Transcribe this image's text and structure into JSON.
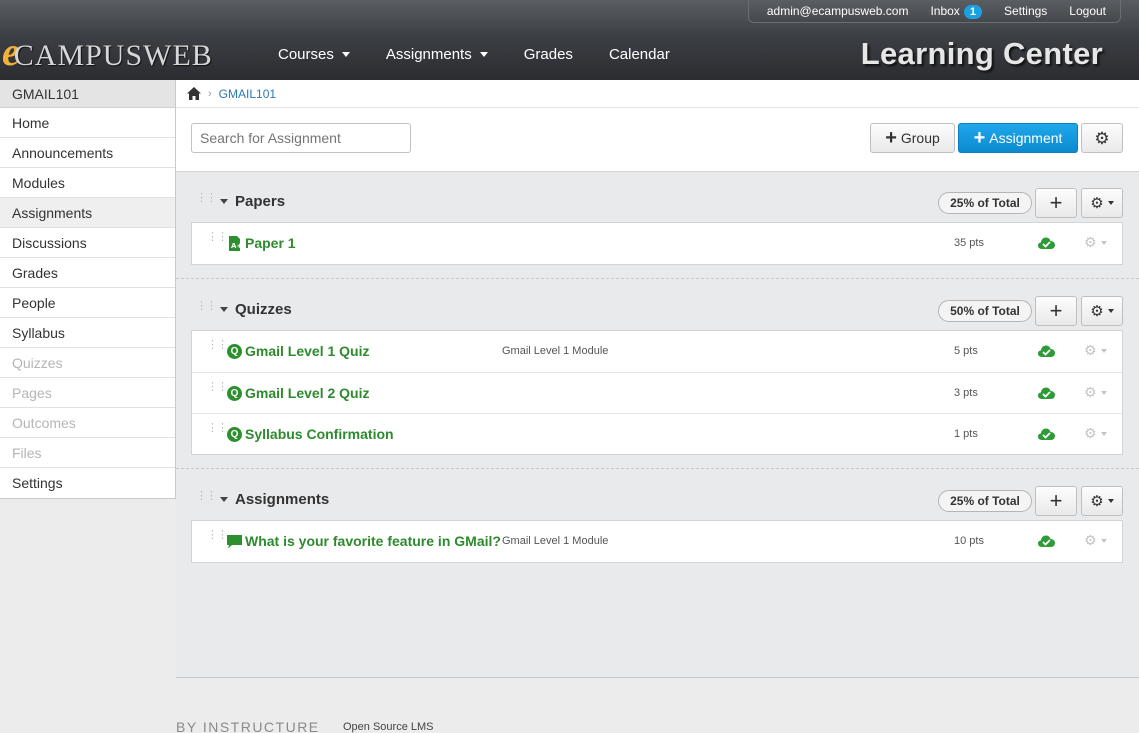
{
  "header": {
    "logo_e": "e",
    "logo_text": "CAMPUSWEB",
    "user_email": "admin@ecampusweb.com",
    "inbox_label": "Inbox",
    "inbox_count": "1",
    "settings_label": "Settings",
    "logout_label": "Logout",
    "nav": [
      {
        "label": "Courses"
      },
      {
        "label": "Assignments"
      },
      {
        "label": "Grades"
      },
      {
        "label": "Calendar"
      }
    ],
    "brand_title": "Learning Center"
  },
  "sidebar": {
    "course_code": "GMAIL101",
    "items": [
      {
        "label": "Home"
      },
      {
        "label": "Announcements"
      },
      {
        "label": "Modules"
      },
      {
        "label": "Assignments"
      },
      {
        "label": "Discussions"
      },
      {
        "label": "Grades"
      },
      {
        "label": "People"
      },
      {
        "label": "Syllabus"
      },
      {
        "label": "Quizzes"
      },
      {
        "label": "Pages"
      },
      {
        "label": "Outcomes"
      },
      {
        "label": "Files"
      },
      {
        "label": "Settings"
      }
    ]
  },
  "breadcrumb": {
    "course": "GMAIL101"
  },
  "toolbar": {
    "search_placeholder": "Search for Assignment",
    "group_label": "Group",
    "assignment_label": "Assignment"
  },
  "groups": [
    {
      "title": "Papers",
      "weight": "25% of Total",
      "items": [
        {
          "title": "Paper 1",
          "module": "",
          "points": "35 pts"
        }
      ]
    },
    {
      "title": "Quizzes",
      "weight": "50% of Total",
      "items": [
        {
          "title": "Gmail Level 1 Quiz",
          "module": "Gmail Level 1 Module",
          "points": "5 pts"
        },
        {
          "title": "Gmail Level 2 Quiz",
          "module": "",
          "points": "3 pts"
        },
        {
          "title": "Syllabus Confirmation",
          "module": "",
          "points": "1 pts"
        }
      ]
    },
    {
      "title": "Assignments",
      "weight": "25% of Total",
      "items": [
        {
          "title": "What is your favorite feature in GMail?",
          "module": "Gmail Level 1 Module",
          "points": "10 pts"
        }
      ]
    }
  ],
  "footer": {
    "brand": "BY INSTRUCTURE",
    "tagline": "Open Source LMS"
  },
  "colors": {
    "accent": "#1ba0e1",
    "item_green": "#2d8b2d",
    "header_dark": "#3c3f44"
  }
}
